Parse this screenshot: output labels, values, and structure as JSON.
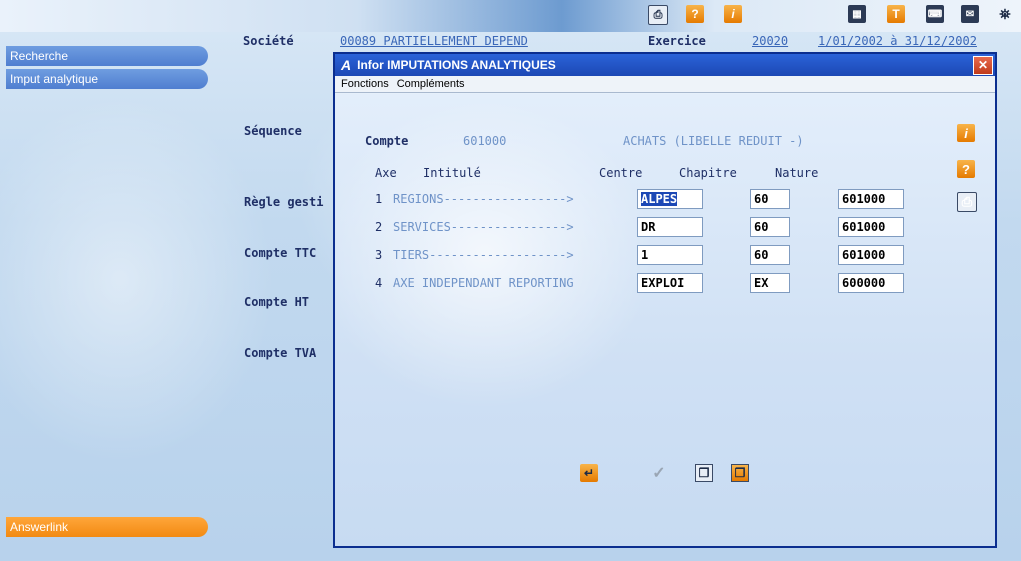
{
  "header": {
    "societe_label": "Société",
    "societe_value": "00089 PARTIELLEMENT DEPEND",
    "exercice_label": "Exercice",
    "exercice_value": "20020",
    "date_range": "1/01/2002 à  31/12/2002"
  },
  "sidebar": {
    "items": [
      {
        "label": "Recherche"
      },
      {
        "label": "Imput analytique"
      }
    ],
    "bottom": {
      "label": "Answerlink"
    }
  },
  "form_labels": {
    "sequence": "Séquence",
    "regle": "Règle gesti",
    "compte_ttc": "Compte TTC",
    "compte_ht": "Compte HT",
    "compte_tva": "Compte TVA"
  },
  "dialog": {
    "app_logo": "A",
    "title": "Infor  IMPUTATIONS ANALYTIQUES",
    "close": "✕",
    "menu": [
      "Fonctions",
      "Compléments"
    ],
    "compte_label": "Compte",
    "compte_value": "601000",
    "compte_desc": "ACHATS (LIBELLE REDUIT -)",
    "columns": {
      "axe": "Axe",
      "intitule": "Intitulé",
      "centre": "Centre",
      "chapitre": "Chapitre",
      "nature": "Nature"
    },
    "rows": [
      {
        "num": "1",
        "intitule": "REGIONS----------------->",
        "centre": "ALPES",
        "chapitre": "60",
        "nature": "601000"
      },
      {
        "num": "2",
        "intitule": "SERVICES---------------->",
        "centre": "DR",
        "chapitre": "60",
        "nature": "601000"
      },
      {
        "num": "3",
        "intitule": "TIERS------------------->",
        "centre": "1",
        "chapitre": "60",
        "nature": "601000"
      },
      {
        "num": "4",
        "intitule": "AXE INDEPENDANT REPORTING",
        "centre": "EXPLOI",
        "chapitre": "EX",
        "nature": "600000"
      }
    ]
  },
  "icons": {
    "top": [
      "print-icon",
      "help-icon",
      "info-icon",
      "calculator-icon",
      "text-icon",
      "keyboard-icon",
      "mail-icon",
      "network-icon"
    ],
    "side": [
      "info-icon",
      "help-icon",
      "print-icon"
    ],
    "bottom": [
      "return-icon",
      "validate-icon",
      "copy-icon",
      "paste-icon"
    ]
  },
  "colors": {
    "accent_orange": "#f28a12",
    "nav_blue": "#4f7ed0",
    "title_blue": "#1c48b5"
  }
}
